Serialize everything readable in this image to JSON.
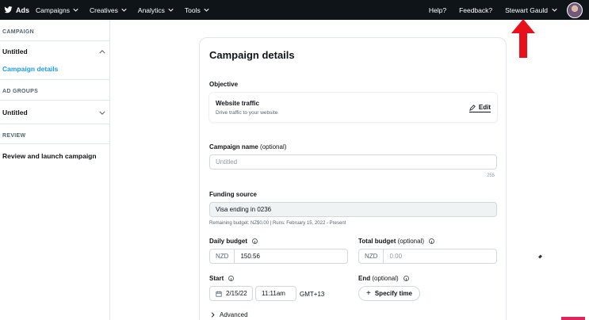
{
  "topbar": {
    "brand": "Ads",
    "nav": [
      {
        "label": "Campaigns"
      },
      {
        "label": "Creatives"
      },
      {
        "label": "Analytics"
      },
      {
        "label": "Tools"
      }
    ],
    "help": "Help?",
    "feedback": "Feedback?",
    "user_name": "Stewart Gauld"
  },
  "sidebar": {
    "campaign_head": "CAMPAIGN",
    "campaign_name": "Untitled",
    "campaign_details": "Campaign details",
    "ad_groups_head": "AD GROUPS",
    "ad_group_name": "Untitled",
    "review_head": "REVIEW",
    "review_link": "Review and launch campaign"
  },
  "card": {
    "title": "Campaign details",
    "objective_label": "Objective",
    "objective_title": "Website traffic",
    "objective_desc": "Drive traffic to your website",
    "edit_label": "Edit",
    "campaign_name_label": "Campaign name",
    "campaign_name_optional": "(optional)",
    "campaign_name_placeholder": "Untitled",
    "campaign_name_counter": "255",
    "funding_label": "Funding source",
    "funding_value": "Visa ending in 0236",
    "funding_note": "Remaining budget: NZ$0.00 | Runs: February 15, 2022 - Present",
    "daily_budget_label": "Daily budget",
    "daily_currency": "NZD",
    "daily_value": "150.56",
    "total_budget_label": "Total budget",
    "total_budget_optional": "(optional)",
    "total_currency": "NZD",
    "total_placeholder": "0.00",
    "start_label": "Start",
    "start_date": "2/15/22",
    "start_time": "11:11am",
    "timezone": "GMT+13",
    "end_label": "End",
    "end_optional": "(optional)",
    "specify_time": "Specify time",
    "advanced": "Advanced"
  },
  "colors": {
    "topbar_bg": "#0f1419",
    "link_blue": "#1d9bf0",
    "annotation_red": "#e8101a"
  }
}
